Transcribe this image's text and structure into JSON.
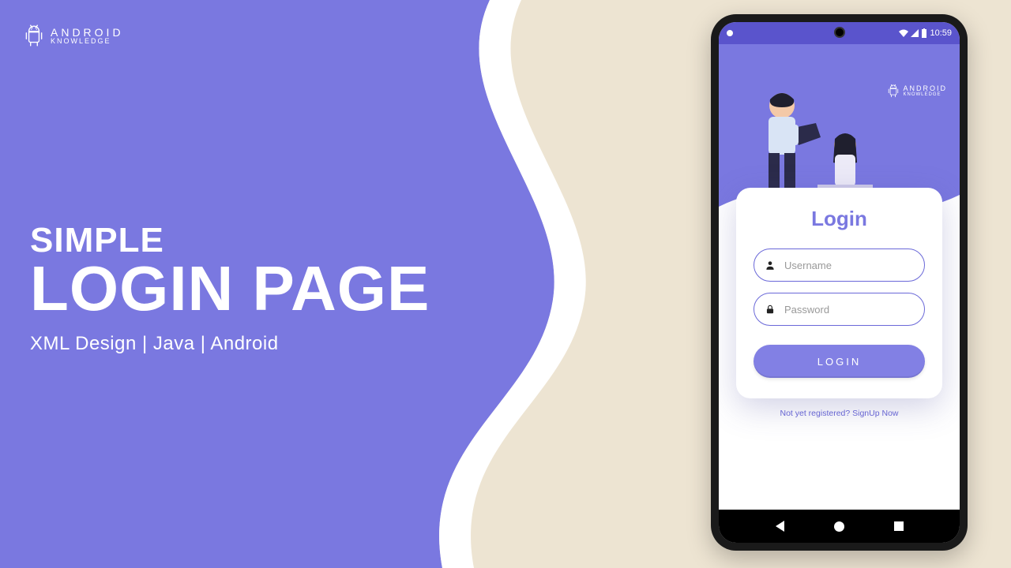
{
  "brand": {
    "line1": "ANDROID",
    "line2": "KNOWLEDGE"
  },
  "hero": {
    "line1": "SIMPLE",
    "line2": "LOGIN PAGE",
    "subtitle": "XML Design | Java | Android"
  },
  "statusbar": {
    "time": "10:59"
  },
  "login": {
    "title": "Login",
    "username_placeholder": "Username",
    "password_placeholder": "Password",
    "button_label": "LOGIN",
    "signup_text": "Not yet registered? SignUp Now"
  },
  "colors": {
    "accent": "#7a78e0",
    "background": "#ede4d2"
  }
}
